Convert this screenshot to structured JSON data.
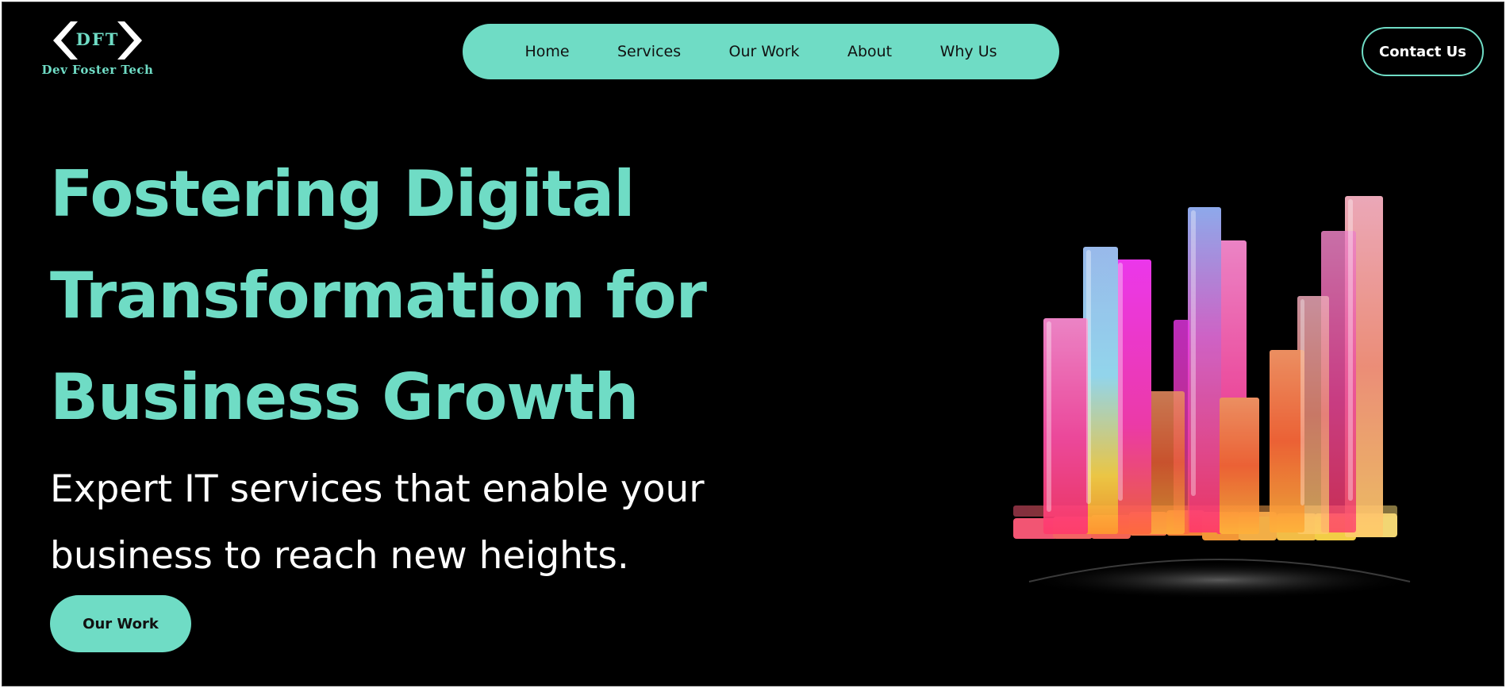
{
  "brand": {
    "logo_code": "DFT",
    "logo_name": "Dev Foster Tech",
    "accent_color": "#6fdcc5",
    "background_color": "#000000"
  },
  "nav": {
    "items": [
      {
        "label": "Home"
      },
      {
        "label": "Services"
      },
      {
        "label": "Our Work"
      },
      {
        "label": "About"
      },
      {
        "label": "Why Us"
      }
    ]
  },
  "header": {
    "contact_label": "Contact Us"
  },
  "hero": {
    "title": "Fostering Digital Transformation for Business Growth",
    "subtitle": "Expert IT services that enable your business to reach new heights.",
    "cta_label": "Our Work",
    "illustration": "glass-bar-chart-illustration"
  }
}
